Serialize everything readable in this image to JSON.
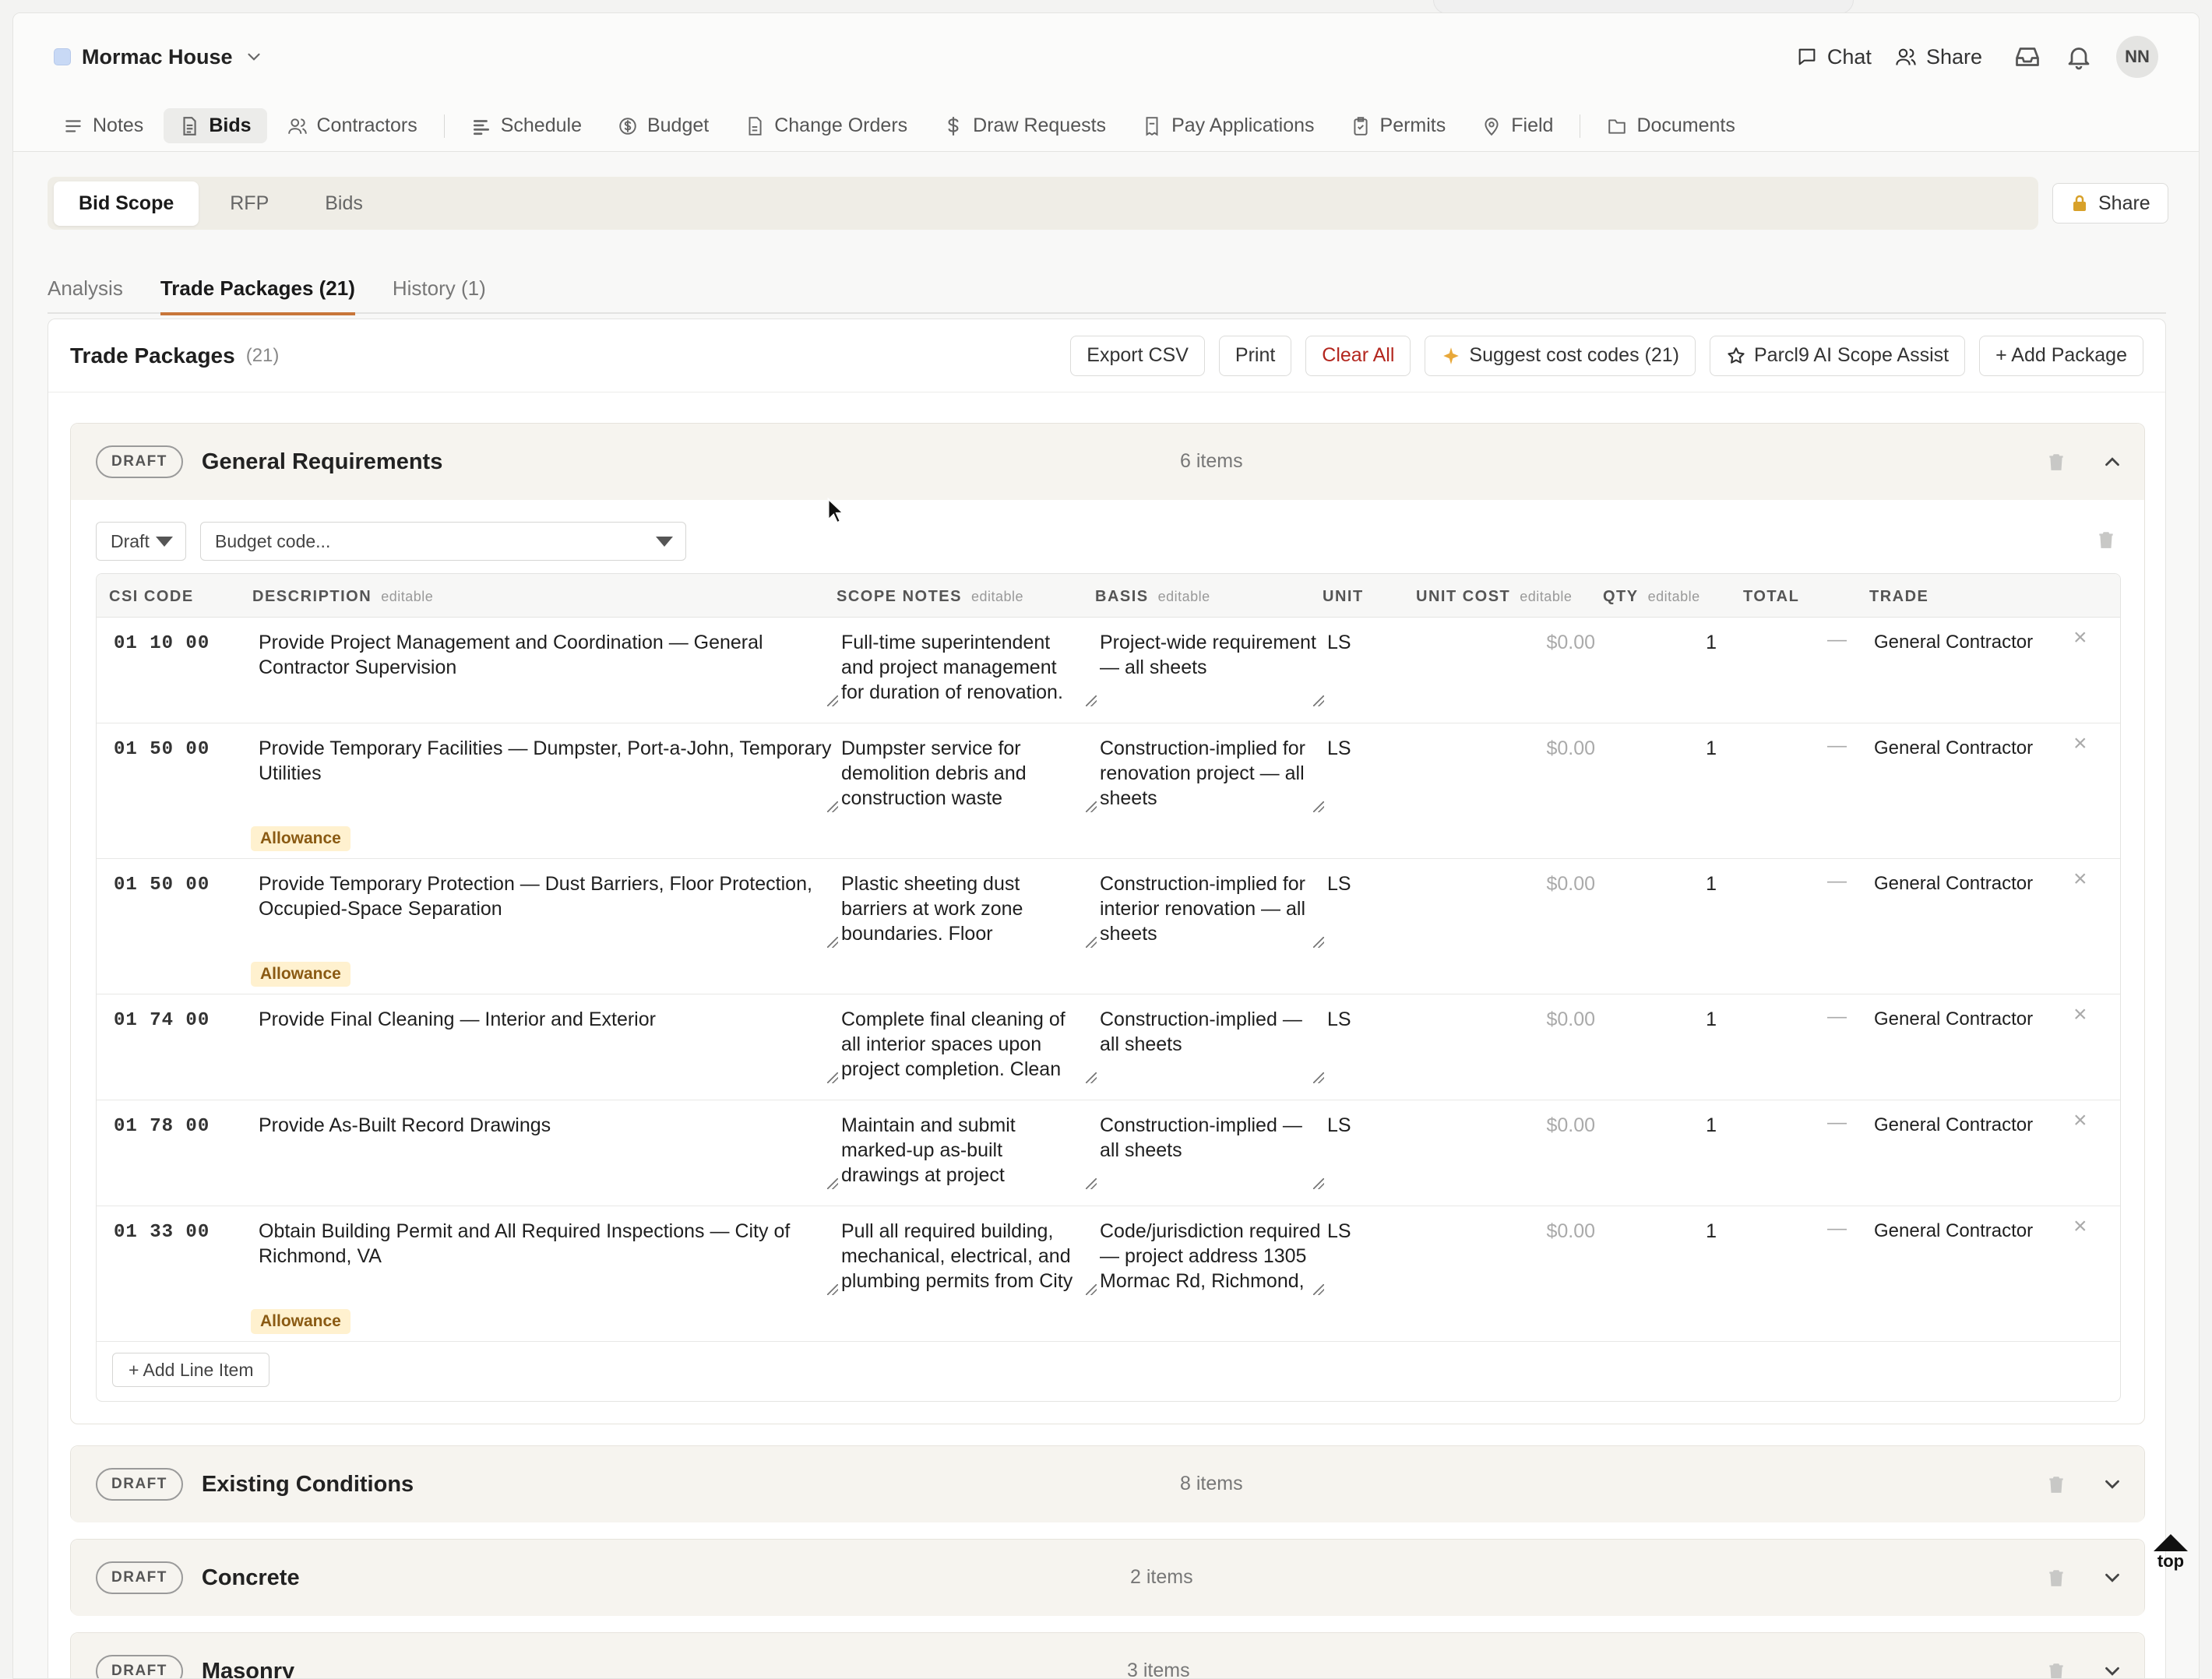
{
  "project": {
    "name": "Mormac House"
  },
  "header": {
    "chat_label": "Chat",
    "share_label": "Share",
    "avatar_initials": "NN"
  },
  "nav": [
    {
      "label": "Notes",
      "icon": "lines-icon"
    },
    {
      "label": "Bids",
      "icon": "document-icon",
      "active": true
    },
    {
      "label": "Contractors",
      "icon": "users-icon"
    },
    {
      "label": "Schedule",
      "icon": "schedule-icon"
    },
    {
      "label": "Budget",
      "icon": "dollar-circle-icon"
    },
    {
      "label": "Change Orders",
      "icon": "file-icon"
    },
    {
      "label": "Draw Requests",
      "icon": "dollar-icon"
    },
    {
      "label": "Pay Applications",
      "icon": "receipt-icon"
    },
    {
      "label": "Permits",
      "icon": "clipboard-icon"
    },
    {
      "label": "Field",
      "icon": "pin-icon"
    },
    {
      "label": "Documents",
      "icon": "folder-icon"
    }
  ],
  "segments": [
    "Bid Scope",
    "RFP",
    "Bids"
  ],
  "segment_share_label": "Share",
  "subtabs": [
    "Analysis",
    "Trade Packages (21)",
    "History (1)"
  ],
  "panel": {
    "title": "Trade Packages",
    "count": "(21)",
    "actions": {
      "export": "Export CSV",
      "print": "Print",
      "clear": "Clear All",
      "suggest": "Suggest cost codes (21)",
      "assist": "Parcl9 AI Scope Assist",
      "add": "+ Add Package"
    }
  },
  "columns": {
    "csi": "CSI CODE",
    "description": "DESCRIPTION",
    "scope_notes": "SCOPE NOTES",
    "basis": "BASIS",
    "unit": "UNIT",
    "unit_cost": "UNIT COST",
    "qty": "QTY",
    "total": "TOTAL",
    "trade": "TRADE",
    "editable": "editable"
  },
  "packages": [
    {
      "status": "DRAFT",
      "name": "General Requirements",
      "items_label": "6 items",
      "filter_status": "Draft",
      "budget_placeholder": "Budget code...",
      "add_line_label": "+ Add Line Item",
      "rows": [
        {
          "csi": "01 10 00",
          "description": "Provide Project Management and Coordination — General Contractor Supervision",
          "scope": "Full-time superintendent and project management for duration of renovation. Coordinate all",
          "basis": "Project-wide requirement — all sheets",
          "unit": "LS",
          "unit_cost": "$0.00",
          "qty": "1",
          "total": "—",
          "trade": "General Contractor",
          "allowance": ""
        },
        {
          "csi": "01 50 00",
          "description": "Provide Temporary Facilities — Dumpster, Port-a-John, Temporary Utilities",
          "scope": "Dumpster service for demolition debris and construction waste throughout",
          "basis": "Construction-implied for renovation project — all sheets",
          "unit": "LS",
          "unit_cost": "$0.00",
          "qty": "1",
          "total": "—",
          "trade": "General Contractor",
          "allowance": "Allowance"
        },
        {
          "csi": "01 50 00",
          "description": "Provide Temporary Protection — Dust Barriers, Floor Protection, Occupied-Space Separation",
          "scope": "Plastic sheeting dust barriers at work zone boundaries. Floor protection on all finished",
          "basis": "Construction-implied for interior renovation — all sheets",
          "unit": "LS",
          "unit_cost": "$0.00",
          "qty": "1",
          "total": "—",
          "trade": "General Contractor",
          "allowance": "Allowance"
        },
        {
          "csi": "01 74 00",
          "description": "Provide Final Cleaning — Interior and Exterior",
          "scope": "Complete final cleaning of all interior spaces upon project completion. Clean all new finishes",
          "basis": "Construction-implied — all sheets",
          "unit": "LS",
          "unit_cost": "$0.00",
          "qty": "1",
          "total": "—",
          "trade": "General Contractor",
          "allowance": ""
        },
        {
          "csi": "01 78 00",
          "description": "Provide As-Built Record Drawings",
          "scope": "Maintain and submit marked-up as-built drawings at project completion. Coordinate",
          "basis": "Construction-implied — all sheets",
          "unit": "LS",
          "unit_cost": "$0.00",
          "qty": "1",
          "total": "—",
          "trade": "General Contractor",
          "allowance": ""
        },
        {
          "csi": "01 33 00",
          "description": "Obtain Building Permit and All Required Inspections — City of Richmond, VA",
          "scope": "Pull all required building, mechanical, electrical, and plumbing permits from City of Richmond. HVAC",
          "basis": "Code/jurisdiction required — project address 1305 Mormac Rd, Richmond, VA",
          "unit": "LS",
          "unit_cost": "$0.00",
          "qty": "1",
          "total": "—",
          "trade": "General Contractor",
          "allowance": "Allowance"
        }
      ]
    },
    {
      "status": "DRAFT",
      "name": "Existing Conditions",
      "items_label": "8 items"
    },
    {
      "status": "DRAFT",
      "name": "Concrete",
      "items_label": "2 items"
    },
    {
      "status": "DRAFT",
      "name": "Masonry",
      "items_label": "3 items"
    }
  ],
  "scroll_top_label": "top"
}
